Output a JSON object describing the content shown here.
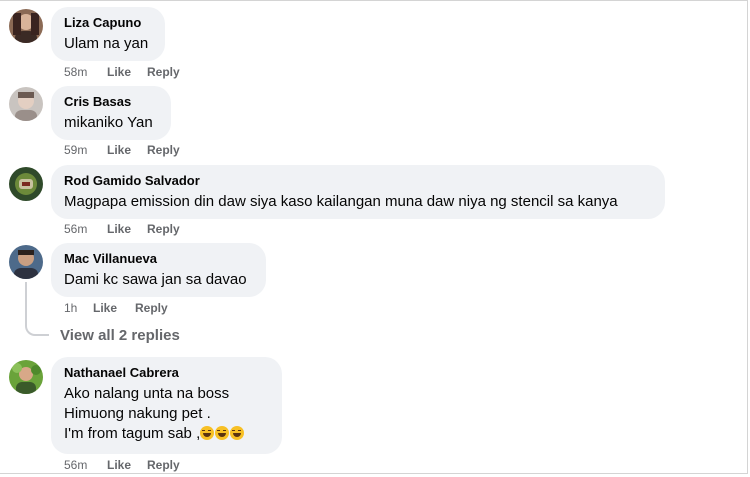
{
  "comments": [
    {
      "author": "Liza Capuno",
      "lines": [
        "Ulam na yan"
      ],
      "time": "58m",
      "like": "Like",
      "reply": "Reply"
    },
    {
      "author": "Cris Basas",
      "lines": [
        "mikaniko Yan"
      ],
      "time": "59m",
      "like": "Like",
      "reply": "Reply"
    },
    {
      "author": "Rod Gamido Salvador",
      "lines": [
        "Magpapa emission din daw siya kaso kailangan muna daw niya ng stencil sa kanya"
      ],
      "time": "56m",
      "like": "Like",
      "reply": "Reply"
    },
    {
      "author": "Mac Villanueva",
      "lines": [
        "Dami kc sawa jan sa davao"
      ],
      "time": "1h",
      "like": "Like",
      "reply": "Reply",
      "view_replies": "View all 2 replies"
    },
    {
      "author": "Nathanael Cabrera",
      "lines": [
        "Ako nalang unta na boss",
        "Himuong nakung pet .",
        "I'm from tagum sab ,"
      ],
      "emoji": "laughing-tears-emoji",
      "emoji_count": 3,
      "time": "56m",
      "like": "Like",
      "reply": "Reply"
    }
  ],
  "colors": {
    "bubble": "#f0f2f5",
    "meta": "#65676b",
    "text": "#050505"
  }
}
